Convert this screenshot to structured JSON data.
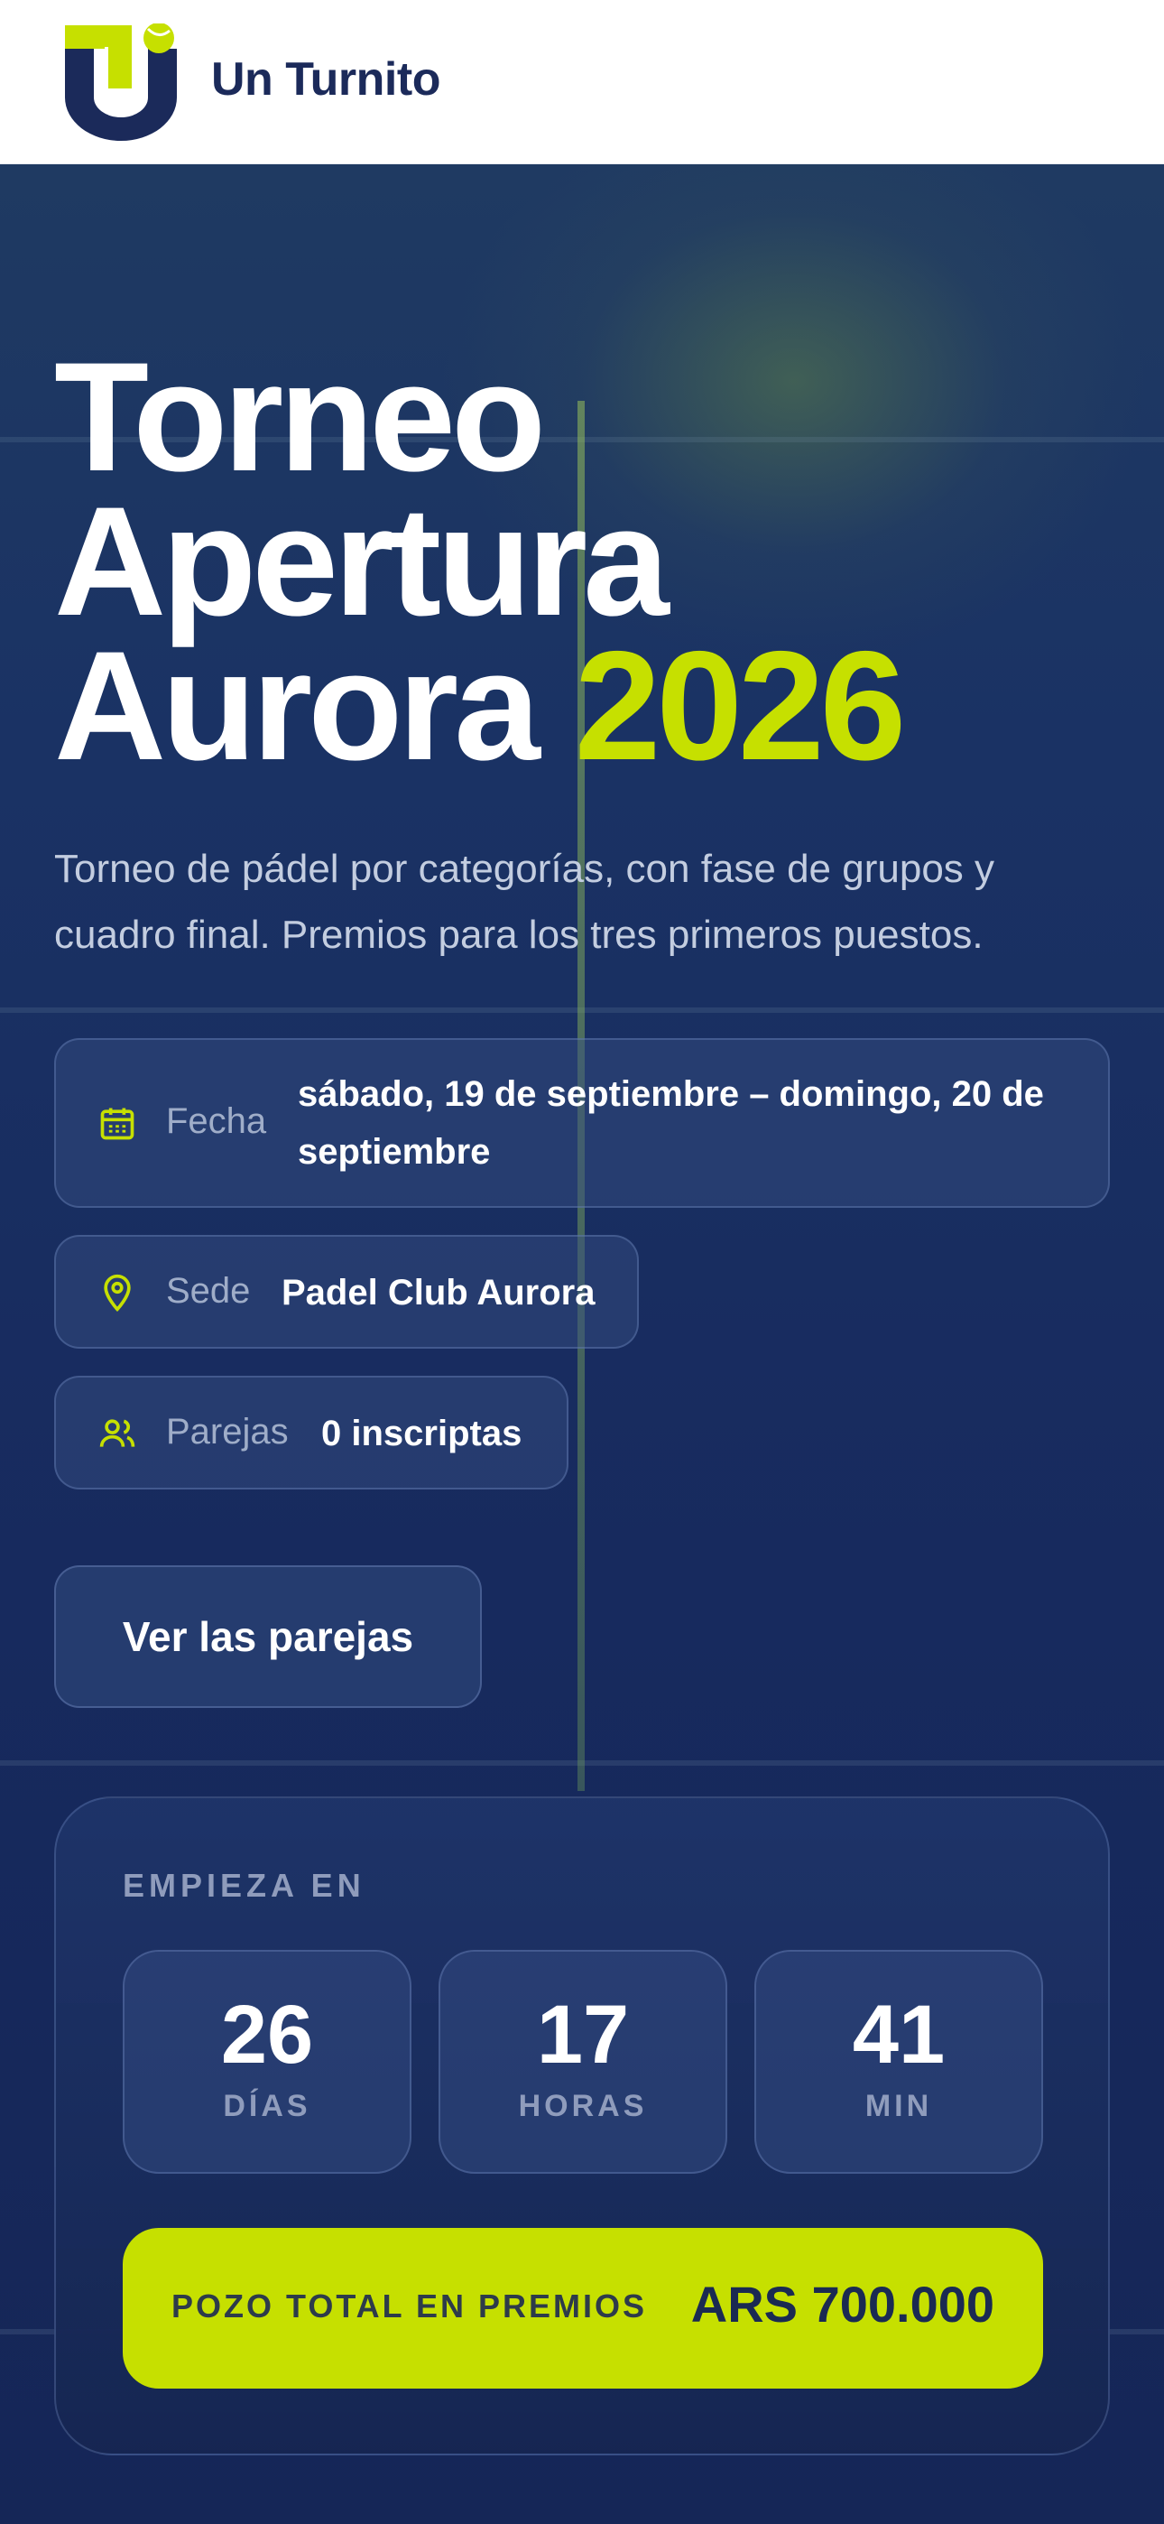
{
  "header": {
    "brand_name": "Un Turnito",
    "logo_icon": "un-turnito-logo",
    "colors": {
      "brand_navy": "#1b2a5a",
      "brand_lime": "#c6e000"
    }
  },
  "hero": {
    "title_line1": "Torneo",
    "title_line2": "Apertura",
    "title_line3_main": "Aurora",
    "title_line3_accent": "2026",
    "subtitle": "Torneo de pádel por categorías, con fase de grupos y cuadro final. Premios para los tres primeros puestos."
  },
  "details": {
    "date": {
      "icon": "calendar-icon",
      "label": "Fecha",
      "value": "sábado, 19 de septiembre – domingo, 20 de septiembre"
    },
    "venue": {
      "icon": "map-pin-icon",
      "label": "Sede",
      "value": "Padel Club Aurora"
    },
    "pairs": {
      "icon": "users-icon",
      "label": "Parejas",
      "value": "0 inscriptas"
    }
  },
  "actions": {
    "view_pairs_label": "Ver las parejas"
  },
  "countdown": {
    "label": "EMPIEZA EN",
    "days": "26",
    "days_unit": "DÍAS",
    "hours": "17",
    "hours_unit": "HORAS",
    "minutes": "41",
    "minutes_unit": "MIN"
  },
  "prize": {
    "label": "POZO TOTAL EN PREMIOS",
    "value": "ARS 700.000"
  }
}
